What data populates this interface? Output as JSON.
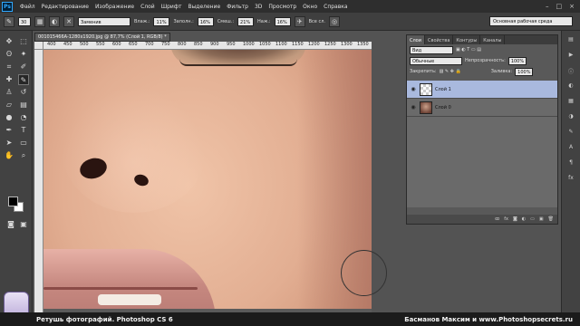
{
  "app": {
    "logo": "Ps"
  },
  "menu": [
    "Файл",
    "Редактирование",
    "Изображение",
    "Слой",
    "Шрифт",
    "Выделение",
    "Фильтр",
    "3D",
    "Просмотр",
    "Окно",
    "Справка"
  ],
  "window_controls": [
    "–",
    "□",
    "×"
  ],
  "options_bar": {
    "brush_size": "30",
    "mode": "Заменив",
    "flow_label": "Влаж.:",
    "flow_value": "11%",
    "fill_label": "Заполн.:",
    "fill_value": "16%",
    "mix_label": "Смеш.:",
    "mix_value": "21%",
    "press_label": "Наж.:",
    "press_value": "16%",
    "all_layers": "Все сл.",
    "workspace": "Основная рабочая среда"
  },
  "document": {
    "tab_title": "001015466A-1280x1920.jpg @ 87,7% (Слой 1, RGB/8) *",
    "ruler_ticks": [
      "400",
      "450",
      "500",
      "550",
      "600",
      "650",
      "700",
      "750",
      "800",
      "850",
      "900",
      "950",
      "1000",
      "1050",
      "1100",
      "1150",
      "1200",
      "1250",
      "1300",
      "1350"
    ]
  },
  "layers_panel": {
    "tabs": [
      "Слои",
      "Свойства",
      "Контуры",
      "Каналы"
    ],
    "filter_label": "Вид",
    "blend_mode": "Обычные",
    "opacity_label": "Непрозрачность:",
    "opacity_value": "100%",
    "lock_label": "Закрепить:",
    "fill_label": "Заливка:",
    "fill_value": "100%",
    "layers": [
      {
        "name": "Слой 1",
        "selected": true
      },
      {
        "name": "Слой 0",
        "selected": false
      }
    ],
    "footer_icons": [
      "ꝏ",
      "fx",
      "◙",
      "◐",
      "▭",
      "▣",
      "🗑"
    ]
  },
  "banner": {
    "left": "Ретушь фотографий. Photoshop CS 6",
    "right": "Басманов Максим и www.Photoshopsecrets.ru"
  }
}
